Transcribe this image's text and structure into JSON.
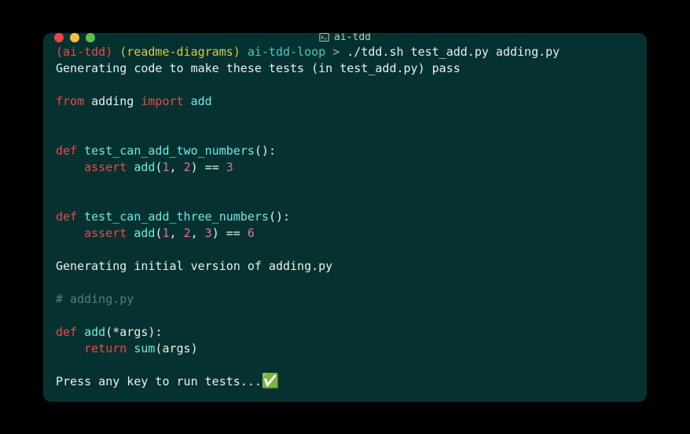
{
  "titlebar": {
    "title": "ai-tdd"
  },
  "prompt": {
    "venv": "(ai-tdd)",
    "branch": "(readme-diagrams)",
    "path": "ai-tdd-loop",
    "sep": ">",
    "command": "./tdd.sh test_add.py adding.py"
  },
  "lines": {
    "gen_tests": "Generating code to make these tests (in test_add.py) pass",
    "blank": "",
    "from_kw": "from",
    "from_mod": " adding ",
    "import_kw": "import",
    "import_name": " add",
    "def_kw": "def",
    "test1_name": " test_can_add_two_numbers",
    "paren_empty": "()",
    "colon": ":",
    "indent": "    ",
    "assert_kw": "assert",
    "add_call": " add",
    "lparen": "(",
    "rparen": ")",
    "n1": "1",
    "comma_sp": ", ",
    "n2": "2",
    "n3": "3",
    "n6": "6",
    "eq": " == ",
    "test2_name": " test_can_add_three_numbers",
    "gen_initial": "Generating initial version of adding.py",
    "comment": "# adding.py",
    "add_def_name": " add",
    "star_args": "*args",
    "return_kw": "return",
    "sum_call": " sum",
    "args_id": "args",
    "press_key": "Press any key to run tests...",
    "check": "✅"
  }
}
